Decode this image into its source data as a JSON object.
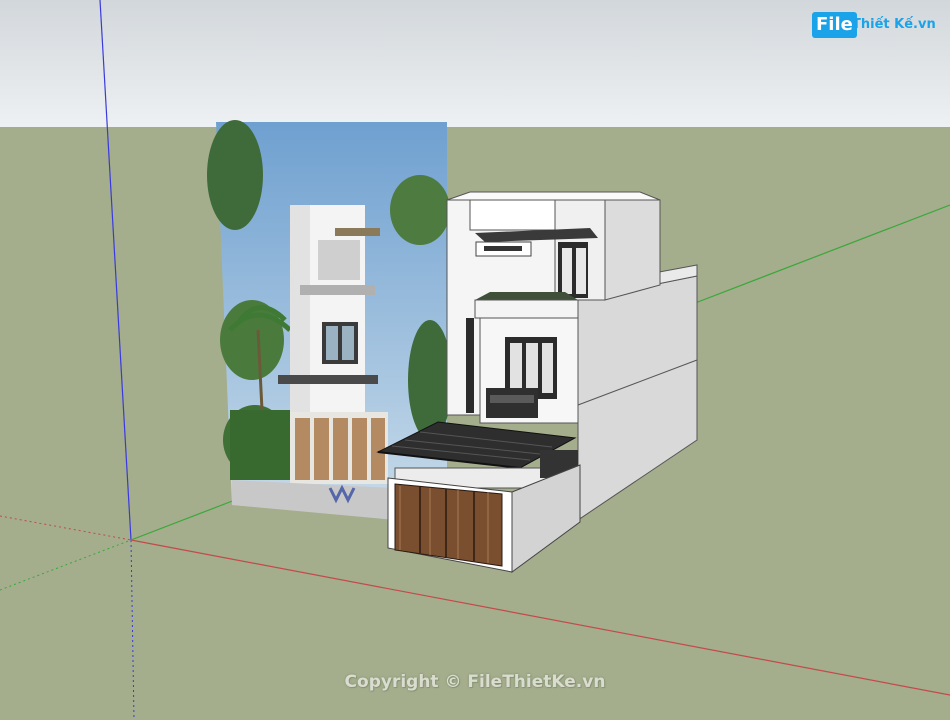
{
  "app": {
    "type": "3d-modeling-viewport",
    "colors": {
      "sky_top": "#d3d8dc",
      "sky_bottom": "#eef1f3",
      "ground": "#a4ad8c",
      "axis_red": "#c44a4a",
      "axis_green": "#3aa83a",
      "axis_blue": "#3a3adc",
      "wall_light": "#f2f2f2",
      "wall_shade": "#d6d6d6",
      "wood": "#7a4f30",
      "roof_dark": "#333333"
    }
  },
  "logo": {
    "file_text": "File",
    "rest_text": "Thiết Kế.vn"
  },
  "watermark": {
    "text": "Copyright © FileThietKe.vn"
  }
}
